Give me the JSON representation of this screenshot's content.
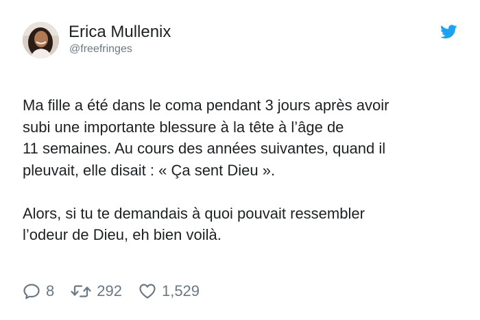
{
  "tweet": {
    "author": {
      "display_name": "Erica Mullenix",
      "handle": "@freefringes",
      "avatar_icon": "profile-photo"
    },
    "brand_icon": "twitter-bird-icon",
    "brand_color": "#1da1f2",
    "text_color": "#1c2022",
    "muted_color": "#697882",
    "paragraphs": [
      "Ma fille a été dans le coma pendant 3 jours après avoir\nsubi une importante blessure à la tête à l’âge de\n11 semaines. Au cours des années suivantes, quand il\npleuvait, elle disait : « Ça sent Dieu ».",
      "Alors, si tu te demandais à quoi pouvait ressembler\nl’odeur de Dieu, eh bien voilà."
    ],
    "actions": {
      "replies": "8",
      "retweets": "292",
      "likes": "1,529"
    }
  }
}
